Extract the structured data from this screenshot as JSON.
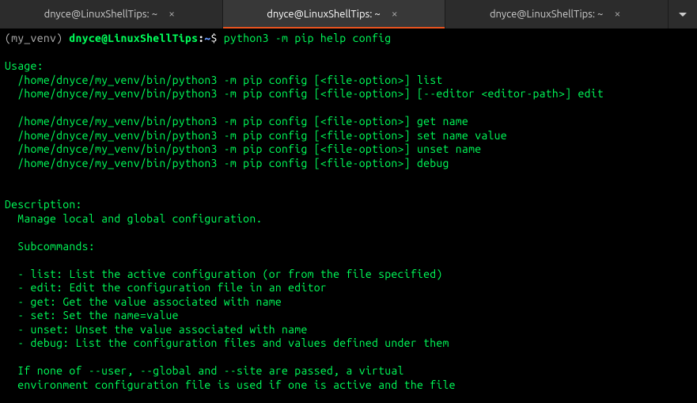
{
  "tabs": [
    {
      "title": "dnyce@LinuxShellTips: ~"
    },
    {
      "title": "dnyce@LinuxShellTips: ~"
    },
    {
      "title": "dnyce@LinuxShellTips: ~"
    }
  ],
  "prompt": {
    "venv": "(my_venv) ",
    "user_host": "dnyce@LinuxShellTips",
    "colon": ":",
    "path": "~",
    "dollar": "$ "
  },
  "command": "python3 -m pip help config",
  "output": {
    "blank0": "",
    "usage_header": "Usage:",
    "usage1": "  /home/dnyce/my_venv/bin/python3 -m pip config [<file-option>] list",
    "usage2": "  /home/dnyce/my_venv/bin/python3 -m pip config [<file-option>] [--editor <editor-path>] edit",
    "blank1": "",
    "usage3": "  /home/dnyce/my_venv/bin/python3 -m pip config [<file-option>] get name",
    "usage4": "  /home/dnyce/my_venv/bin/python3 -m pip config [<file-option>] set name value",
    "usage5": "  /home/dnyce/my_venv/bin/python3 -m pip config [<file-option>] unset name",
    "usage6": "  /home/dnyce/my_venv/bin/python3 -m pip config [<file-option>] debug",
    "blank2": "",
    "blank3": "",
    "desc_header": "Description:",
    "desc1": "  Manage local and global configuration.",
    "blank4": "",
    "sub_header": "  Subcommands:",
    "blank5": "",
    "sub1": "  - list: List the active configuration (or from the file specified)",
    "sub2": "  - edit: Edit the configuration file in an editor",
    "sub3": "  - get: Get the value associated with name",
    "sub4": "  - set: Set the name=value",
    "sub5": "  - unset: Unset the value associated with name",
    "sub6": "  - debug: List the configuration files and values defined under them",
    "blank6": "",
    "note1": "  If none of --user, --global and --site are passed, a virtual",
    "note2": "  environment configuration file is used if one is active and the file"
  }
}
